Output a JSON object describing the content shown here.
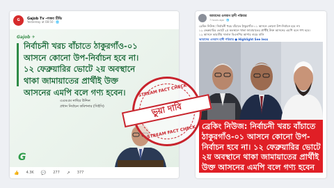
{
  "left_post": {
    "page_name": "Gajob Tv -গজব টিভি",
    "timestamp": "Yesterday at 08:50 · 🌐",
    "avatar_text": "G",
    "card_logo": "Gajob ✈",
    "headline_line1": "নির্বাচনী খরচ বাঁচাতে ঠাকুরগাঁও-০১",
    "headline_line2": "আসনে কোনো উপ-নির্বাচন হবে না।",
    "headline_line3": "১২ ফেব্রুয়ারির ভোটে ২য় অবস্থানে",
    "headline_line4": "থাকা জামায়াতের প্রার্থীই উক্ত",
    "headline_line5": "আসনের এমপি বলে গণ্য হবেন।",
    "speaker_name": "এএমএম নাছির উদ্দিন",
    "speaker_title": "প্রধান নির্বাচন কমিশনার (সিইসি)",
    "footer_logo": "G",
    "reactions": "4.3K",
    "comments": "277",
    "shares": "377"
  },
  "stamp": {
    "top_text": "STREAM FACT CHECK",
    "band_text": "ভুয়া দাবি",
    "bottom_text": "STREAM FACT CHECK"
  },
  "right_post": {
    "page_name": "আমাদের ওসমান হাদী পরিবার",
    "timestamp": "7 hours ago · 🌐",
    "body_line1": "ব্রেকিং নিউজ: নির্বাচনী খরচ বাঁচাতে ঠাকুরগাঁও-০১ আসনে কোনো উপ-নির্বাচন হবে না।",
    "body_line2": "১২ ফেব্রুয়ারির ভোটে ২য় অবস্থানে থাকা জামায়াতের প্রার্থীই উক্ত আসনের এমপি বলে গণ্য হবে।",
    "body_line3": "১২ আসনে ভারতীয় দালাল বিএনপির আশার গুড়ে বালি",
    "tags": "আমাদের ওসমান হাদী পরিবার  ● Highlight See less",
    "caption_line1": "ব্রেকিং নিউজ: নির্বাচনী খরচ বাঁচাতে",
    "caption_line2": "ঠাকুরগাঁও-০১ আসনে কোনো উপ-",
    "caption_line3": "নির্বাচন হবে না। ১২ ফেব্রুয়ারির ভোটে",
    "caption_line4": "২য় অবস্থানে থাকা জামায়াতের প্রার্থীই",
    "caption_line5": "উক্ত আসনের এমপি বলে গণ্য হবেন"
  }
}
